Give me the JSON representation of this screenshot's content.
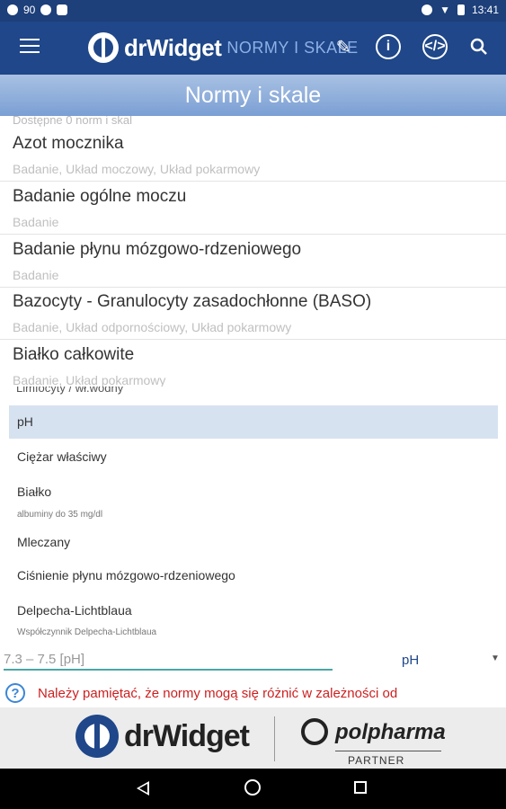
{
  "status_bar": {
    "left_icons": [
      "chat-icon",
      "soccer-ball-icon",
      "android-icon"
    ],
    "notification_count": "90",
    "right_icons": [
      "sync-icon",
      "wifi-icon",
      "battery-icon"
    ],
    "time": "13:41"
  },
  "app_bar": {
    "brand": "drWidget",
    "section": "NORMY I SKALE",
    "actions": [
      "menu-icon",
      "pencil-icon",
      "info-icon",
      "code-icon",
      "search-icon"
    ]
  },
  "title": "Normy i skale",
  "list": {
    "available_text": "Dostępne 0 norm i skal",
    "items": [
      {
        "title": "Azot mocznika",
        "tags": "Badanie, Układ moczowy, Układ pokarmowy"
      },
      {
        "title": "Badanie ogólne moczu",
        "tags": "Badanie"
      },
      {
        "title": "Badanie płynu mózgowo-rdzeniowego",
        "tags": "Badanie"
      },
      {
        "title": "Bazocyty - Granulocyty zasadochłonne (BASO)",
        "tags": "Badanie, Układ odpornościowy, Układ pokarmowy"
      },
      {
        "title": "Białko całkowite",
        "tags": "Badanie, Układ pokarmowy"
      }
    ]
  },
  "dropdown": {
    "ghost_text": "Limfocyty / wł.wodny",
    "options": [
      {
        "label": "pH",
        "selected": true
      },
      {
        "label": "Ciężar właściwy"
      },
      {
        "label": "Białko",
        "note": "albuminy do 35 mg/dl"
      },
      {
        "label": "Mleczany"
      },
      {
        "label": "Ciśnienie płynu mózgowo-rdzeniowego"
      },
      {
        "label": "Delpecha-Lichtblaua",
        "note": "Współczynnik Delpecha-Lichtblaua"
      }
    ]
  },
  "input_row": {
    "value": "7.3 – 7.5 [pH]",
    "selected_option": "pH"
  },
  "note": {
    "text": "Należy pamiętać, że normy mogą się różnić w zależności od"
  },
  "footer": {
    "brand": "drWidget",
    "partner_name": "polpharma",
    "partner_label": "PARTNER"
  },
  "nav_bar": [
    "back-icon",
    "home-icon",
    "recent-apps-icon"
  ],
  "colors": {
    "primary": "#1f4789",
    "title_bar": "#8aaadc",
    "accent": "#4aa6a6",
    "warning": "#cc1f1f"
  }
}
